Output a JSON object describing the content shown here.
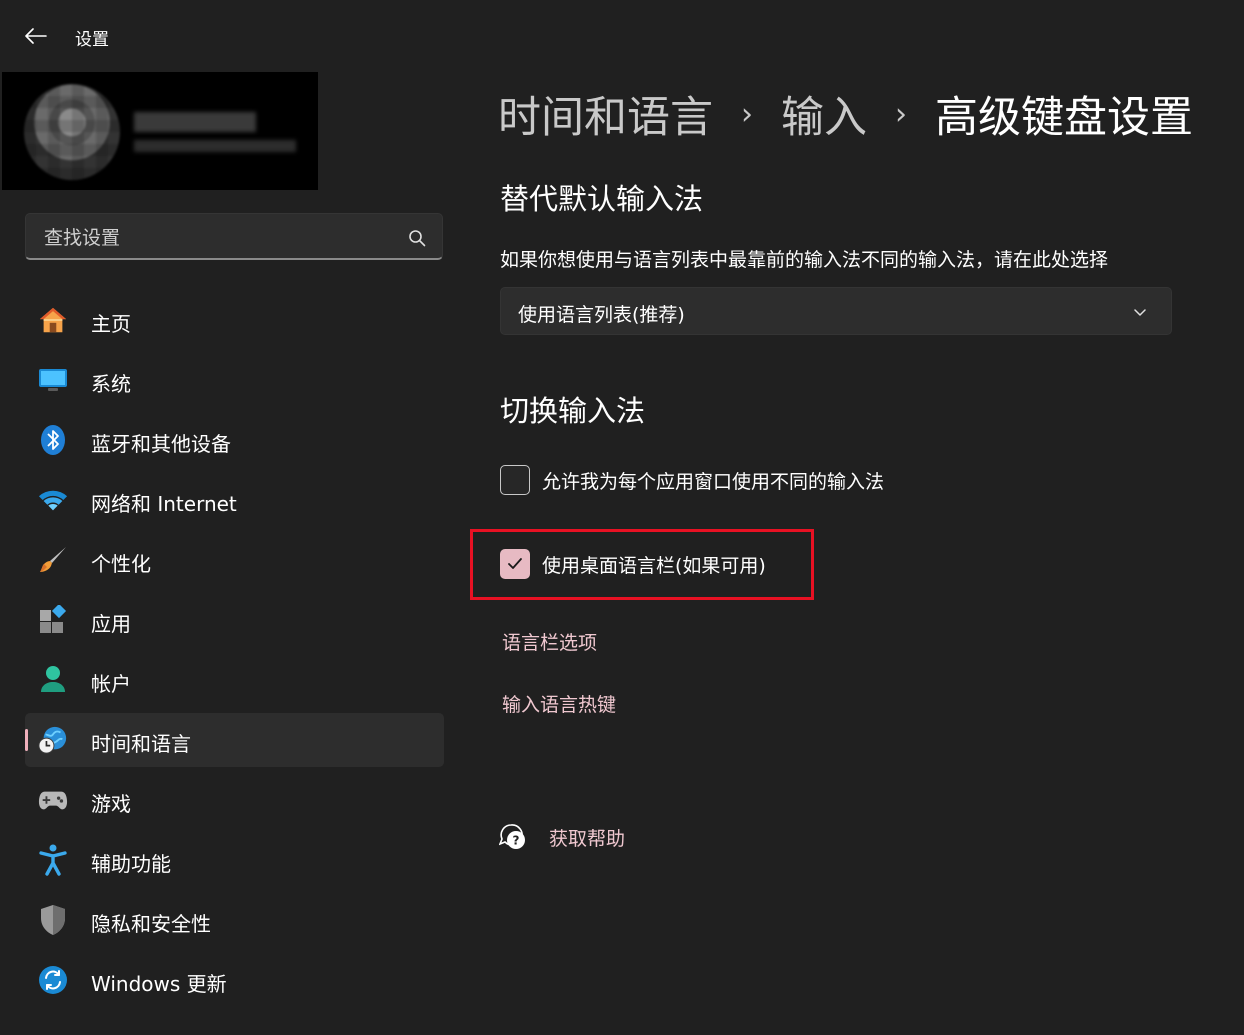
{
  "window": {
    "title": "设置"
  },
  "search": {
    "placeholder": "查找设置"
  },
  "sidebar": {
    "items": [
      {
        "label": "主页",
        "icon": "home-icon"
      },
      {
        "label": "系统",
        "icon": "monitor-icon"
      },
      {
        "label": "蓝牙和其他设备",
        "icon": "bluetooth-icon"
      },
      {
        "label": "网络和 Internet",
        "icon": "wifi-icon"
      },
      {
        "label": "个性化",
        "icon": "brush-icon"
      },
      {
        "label": "应用",
        "icon": "apps-icon"
      },
      {
        "label": "帐户",
        "icon": "account-icon"
      },
      {
        "label": "时间和语言",
        "icon": "globe-clock-icon",
        "active": true
      },
      {
        "label": "游戏",
        "icon": "gamepad-icon"
      },
      {
        "label": "辅助功能",
        "icon": "accessibility-icon"
      },
      {
        "label": "隐私和安全性",
        "icon": "shield-icon"
      },
      {
        "label": "Windows 更新",
        "icon": "update-icon"
      }
    ]
  },
  "breadcrumb": {
    "level1": "时间和语言",
    "level2": "输入",
    "current": "高级键盘设置",
    "separator": "›"
  },
  "override": {
    "title": "替代默认输入法",
    "description": "如果你想使用与语言列表中最靠前的输入法不同的输入法，请在此处选择",
    "dropdown_value": "使用语言列表(推荐)"
  },
  "switching": {
    "title": "切换输入法",
    "per_app_label": "允许我为每个应用窗口使用不同的输入法",
    "per_app_checked": false,
    "langbar_label": "使用桌面语言栏(如果可用)",
    "langbar_checked": true
  },
  "links": {
    "langbar_options": "语言栏选项",
    "hotkeys": "输入语言热键"
  },
  "help": {
    "label": "获取帮助"
  },
  "colors": {
    "accent": "#e7bac3",
    "link": "#f0c8d0",
    "highlight_box": "#e81123",
    "background": "#202020"
  }
}
